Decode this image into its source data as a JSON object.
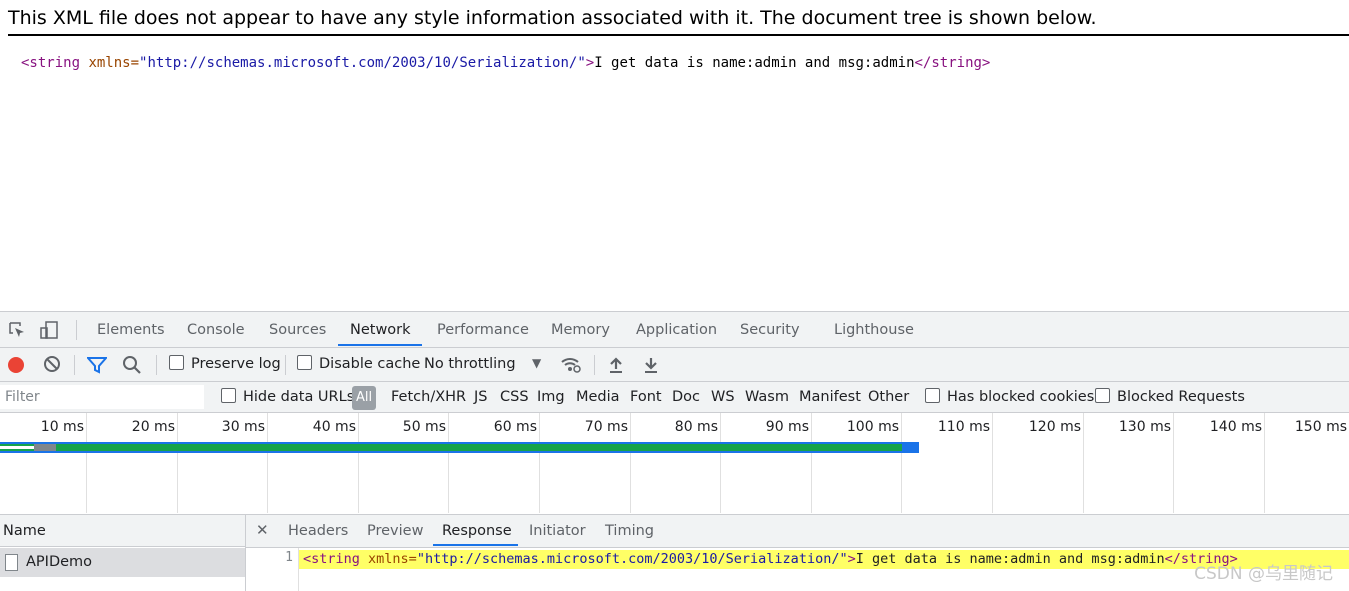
{
  "xml_notice": "This XML file does not appear to have any style information associated with it. The document tree is shown below.",
  "xml_tree": {
    "open_tag_start": "<string",
    "attr_name": " xmlns=",
    "attr_value": "\"http://schemas.microsoft.com/2003/10/Serialization/\"",
    "open_tag_end": ">",
    "text": "I get data is name:admin and msg:admin",
    "close_tag": "</string>"
  },
  "devtools": {
    "tabs": [
      "Elements",
      "Console",
      "Sources",
      "Network",
      "Performance",
      "Memory",
      "Application",
      "Security",
      "Lighthouse"
    ],
    "active_tab": "Network",
    "toolbar": {
      "preserve_log": "Preserve log",
      "disable_cache": "Disable cache",
      "throttling": "No throttling"
    },
    "filterbar": {
      "filter_placeholder": "Filter",
      "hide_data_urls": "Hide data URLs",
      "all": "All",
      "types": [
        "Fetch/XHR",
        "JS",
        "CSS",
        "Img",
        "Media",
        "Font",
        "Doc",
        "WS",
        "Wasm",
        "Manifest",
        "Other"
      ],
      "has_blocked_cookies": "Has blocked cookies",
      "blocked_requests": "Blocked Requests"
    },
    "timeline": {
      "ticks": [
        "10 ms",
        "20 ms",
        "30 ms",
        "40 ms",
        "50 ms",
        "60 ms",
        "70 ms",
        "80 ms",
        "90 ms",
        "100 ms",
        "110 ms",
        "120 ms",
        "130 ms",
        "140 ms",
        "150 ms"
      ]
    },
    "requests": {
      "column_header": "Name",
      "rows": [
        {
          "name": "APIDemo"
        }
      ]
    },
    "detail": {
      "tabs": [
        "Headers",
        "Preview",
        "Response",
        "Initiator",
        "Timing"
      ],
      "active_tab": "Response",
      "line_number": "1",
      "response": {
        "open_tag_start": "<string",
        "attr_name": " xmlns=",
        "attr_value": "\"http://schemas.microsoft.com/2003/10/Serialization/\"",
        "open_tag_end": ">",
        "text": "I get data is name:admin and msg:admin",
        "close_tag": "</string>"
      }
    }
  },
  "watermark": "CSDN @乌里随记",
  "colors": {
    "record": "#ea4335",
    "accent": "#1a73e8",
    "highlight": "#ffff66",
    "xml_tag": "#881280",
    "xml_attr": "#994500",
    "xml_value": "#1a1aa6"
  }
}
